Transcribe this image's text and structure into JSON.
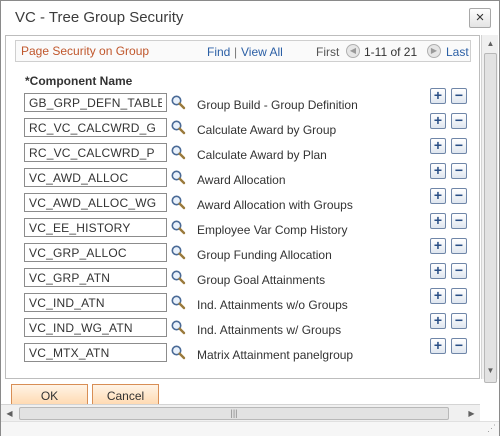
{
  "dialog": {
    "title": "VC - Tree Group Security",
    "close_glyph": "×"
  },
  "grid": {
    "title": "Page Security on Group",
    "find": "Find",
    "separator": "|",
    "view_all": "View All",
    "first": "First",
    "range": "1-11 of 21",
    "last": "Last",
    "column_header": "*Component Name"
  },
  "rows": [
    {
      "code": "GB_GRP_DEFN_TABLE",
      "desc": "Group Build - Group Definition"
    },
    {
      "code": "RC_VC_CALCWRD_G",
      "desc": "Calculate Award by Group"
    },
    {
      "code": "RC_VC_CALCWRD_P",
      "desc": "Calculate Award by Plan"
    },
    {
      "code": "VC_AWD_ALLOC",
      "desc": "Award Allocation"
    },
    {
      "code": "VC_AWD_ALLOC_WG",
      "desc": "Award Allocation with Groups"
    },
    {
      "code": "VC_EE_HISTORY",
      "desc": "Employee Var Comp History"
    },
    {
      "code": "VC_GRP_ALLOC",
      "desc": "Group Funding Allocation"
    },
    {
      "code": "VC_GRP_ATN",
      "desc": "Group Goal Attainments"
    },
    {
      "code": "VC_IND_ATN",
      "desc": "Ind. Attainments w/o Groups"
    },
    {
      "code": "VC_IND_WG_ATN",
      "desc": "Ind. Attainments w/ Groups"
    },
    {
      "code": "VC_MTX_ATN",
      "desc": "Matrix Attainment panelgroup"
    }
  ],
  "row_buttons": {
    "add": "+",
    "delete": "−"
  },
  "footer": {
    "ok": "OK",
    "cancel": "Cancel"
  },
  "scroll": {
    "up": "▲",
    "down": "▼",
    "left": "◀",
    "right": "▶",
    "thumb_grip": "|||"
  },
  "grip": "⋰",
  "icons": {
    "lookup": "magnifier-icon",
    "prev": "prev-arrow-icon",
    "next": "next-arrow-icon"
  },
  "colors": {
    "grid_title": "#c0572c",
    "link": "#2b5fa5",
    "button_border": "#d88e55"
  }
}
